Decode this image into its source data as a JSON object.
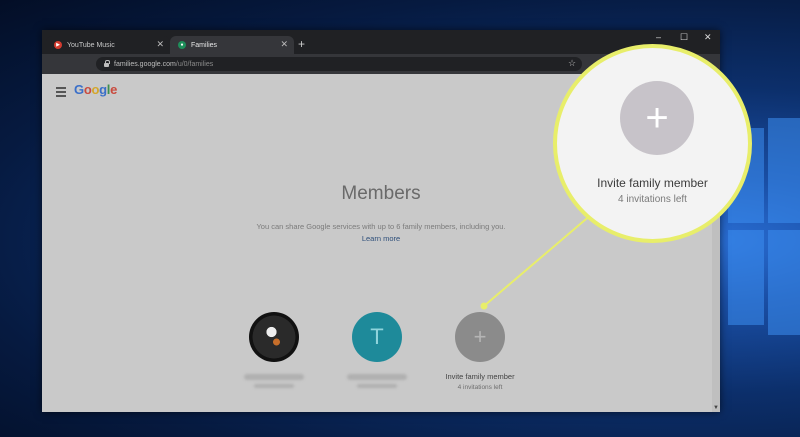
{
  "browser": {
    "tabs": [
      {
        "label": "YouTube Music",
        "favicon_color": "#d23b2f",
        "active": false
      },
      {
        "label": "Families",
        "favicon_color": "#1e8e5a",
        "active": true
      }
    ],
    "address": {
      "host": "families.google.com",
      "path": "/u/0/families"
    }
  },
  "page": {
    "logo": [
      "G",
      "o",
      "o",
      "g",
      "l",
      "e"
    ],
    "title": "Members",
    "description": "You can share Google services with up to 6 family members, including you.",
    "learn_more": "Learn more",
    "member_initial": "T",
    "invite": {
      "plus": "+",
      "label": "Invite family member",
      "sub": "4 invitations left"
    }
  },
  "callout": {
    "plus": "+",
    "title": "Invite family member",
    "sub": "4 invitations left"
  },
  "colors": {
    "callout_ring": "#e8ee6a",
    "member_t": "#1e8a9a"
  }
}
